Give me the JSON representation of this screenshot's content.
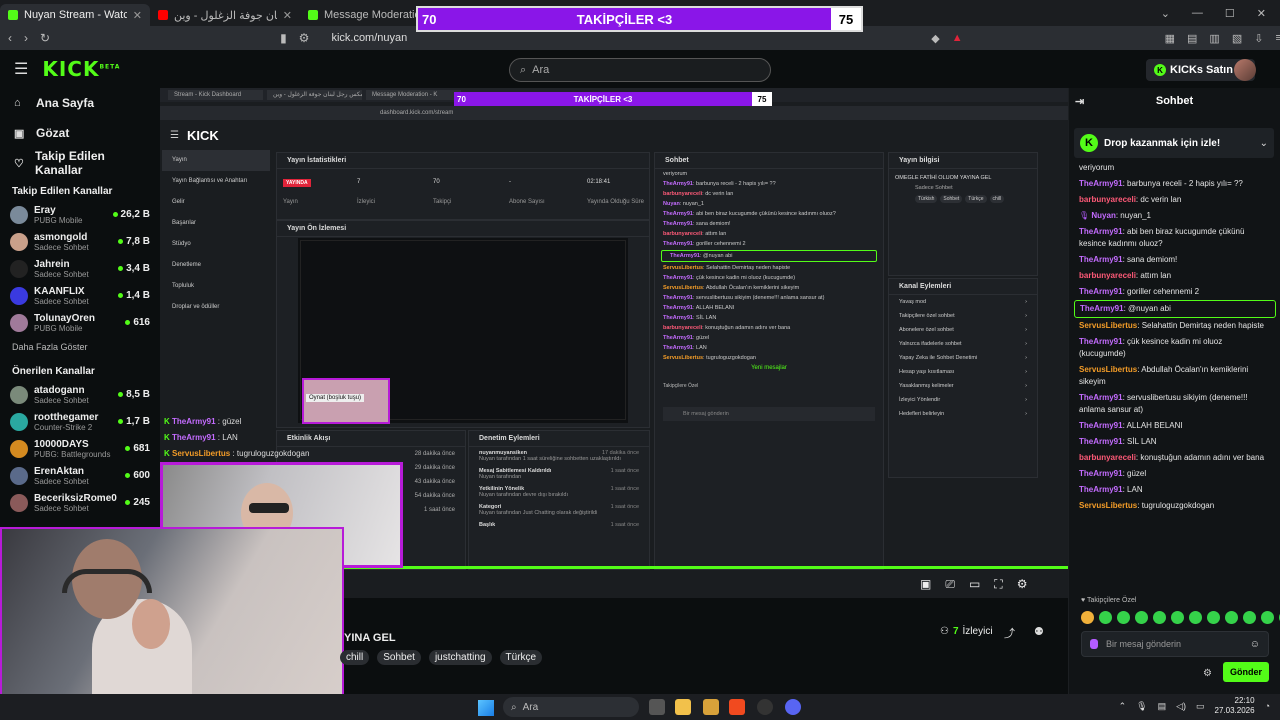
{
  "browser": {
    "tabs": [
      {
        "title": "Nuyan Stream - Watch Live on K",
        "active": true,
        "color": "#53fc18"
      },
      {
        "title": "ريمكس رجل لبنان جوفة الزغلول - وين",
        "active": false,
        "color": "#ff0000"
      },
      {
        "title": "Message Moderation - K",
        "active": false,
        "color": "#53fc18"
      }
    ],
    "url": "kick.com/nuyan"
  },
  "follower_goal": {
    "current": "70",
    "label": "TAKİPÇİLER <3",
    "target": "75",
    "progress": 0.93,
    "color": "#8a16e8"
  },
  "header": {
    "logo": "KICK",
    "logo_sup": "BETA",
    "search_placeholder": "Ara",
    "buy_label": "KICKs Satın Al"
  },
  "sidebar": {
    "nav": [
      {
        "label": "Ana Sayfa",
        "icon": "home-icon",
        "glyph": "⌂"
      },
      {
        "label": "Gözat",
        "icon": "browse-icon",
        "glyph": "▣"
      },
      {
        "label": "Takip Edilen Kanallar",
        "icon": "heart-icon",
        "glyph": "♡"
      }
    ],
    "followed_title": "Takip Edilen Kanallar",
    "followed": [
      {
        "name": "Eray",
        "category": "PUBG Mobile",
        "viewers": "26,2 B",
        "color": "#7a8a9a"
      },
      {
        "name": "asmongold",
        "category": "Sadece Sohbet",
        "viewers": "7,8 B",
        "color": "#c9a08a"
      },
      {
        "name": "Jahrein",
        "category": "Sadece Sohbet",
        "viewers": "3,4 B",
        "color": "#222222"
      },
      {
        "name": "KAANFLIX",
        "category": "Sadece Sohbet",
        "viewers": "1,4 B",
        "color": "#3a3ae0"
      },
      {
        "name": "TolunayOren",
        "category": "PUBG Mobile",
        "viewers": "616",
        "color": "#a07a9a"
      }
    ],
    "show_more": "Daha Fazla Göster",
    "recommended_title": "Önerilen Kanallar",
    "recommended": [
      {
        "name": "atadogann",
        "category": "Sadece Sohbet",
        "viewers": "8,5 B",
        "color": "#7a8a7a"
      },
      {
        "name": "rootthegamer",
        "category": "Counter-Strike 2",
        "viewers": "1,7 B",
        "color": "#2aa8a0"
      },
      {
        "name": "10000DAYS",
        "category": "PUBG: Battlegrounds",
        "viewers": "681",
        "color": "#d48a20"
      },
      {
        "name": "ErenAktan",
        "category": "Sadece Sohbet",
        "viewers": "600",
        "color": "#5a6a8a"
      },
      {
        "name": "BeceriksizRome0",
        "category": "Sadece Sohbet",
        "viewers": "245",
        "color": "#8a5a5a"
      }
    ]
  },
  "mini": {
    "tabs": [
      "Stream - Kick Dashboard",
      "ريمكس رجل لبنان جوفة الزغلول - وين",
      "Message Moderation - K"
    ],
    "url": "dashboard.kick.com/stream",
    "logo": "KICK",
    "follow_current": "70",
    "follow_label": "TAKİPÇİLER <3",
    "follow_target": "75",
    "side": [
      "Yayın",
      "Yayın Bağlantısı ve Anahtarı",
      "Gelir",
      "Başarılar",
      "Stüdyo",
      "Denetleme",
      "Topluluk",
      "Droplar ve ödüller"
    ],
    "stats_title": "Yayın İstatistikleri",
    "stats": [
      {
        "value": "YAYINDA",
        "label": "Yayın"
      },
      {
        "value": "7",
        "label": "İzleyici"
      },
      {
        "value": "70",
        "label": "Takipçi"
      },
      {
        "value": "-",
        "label": "Abone Sayısı"
      },
      {
        "value": "02:18:41",
        "label": "Yayında Olduğu Süre"
      }
    ],
    "preview_title": "Yayın Ön İzlemesi",
    "preview_tooltip": "Oynat (boşluk tuşu)",
    "activity_title": "Etkinlik Akışı",
    "activity": [
      "28 dakika önce",
      "29 dakika önce",
      "43 dakika önce",
      "54 dakika önce",
      "1 saat önce"
    ],
    "mod_title": "Denetim Eylemleri",
    "mod_actions": [
      {
        "name": "nuyanmuyansiken",
        "desc": "Nuyan tarafından 1 saat süreliğine sohbetten uzaklaştırıldı",
        "time": "17 dakika önce"
      },
      {
        "name": "Mesaj Sabitlemesi Kaldırıldı",
        "desc": "Nuyan tarafından",
        "time": "1 saat önce"
      },
      {
        "name": "Yetkilinin Yönelik",
        "desc": "Nuyan tarafından devre dışı bırakıldı",
        "time": "1 saat önce"
      },
      {
        "name": "Kategori",
        "desc": "Nuyan tarafından Just Chatting olarak değiştirildi",
        "time": "1 saat önce"
      },
      {
        "name": "Başlık",
        "desc": "",
        "time": "1 saat önce"
      }
    ],
    "chat_title": "Sohbet",
    "new_messages": "Yeni mesajlar",
    "mini_subs_label": "Takipçilere Özel",
    "chat_placeholder": "Bir mesaj gönderin",
    "send": "Gönder",
    "info_title": "Yayın bilgisi",
    "info_stream_title": "OMEGLE FATİHİ OLUOM YAYINA GEL",
    "info_category": "Sadece Sohbet",
    "info_tags": [
      "Türkish",
      "Sohbet",
      "Türkçe",
      "chill"
    ],
    "channel_actions_title": "Kanal Eylemleri",
    "channel_actions": [
      "Yavaş mod",
      "Takipçilere özel sohbet",
      "Abonelere özel sohbet",
      "Yalnızca ifadelerle sohbet",
      "Yapay Zeka ile Sohbet Denetimi",
      "Hesap yaşı kısıtlaması",
      "Yasaklanmış kelimeler",
      "İzleyici Yönlendir",
      "Hedefleri belirleyin"
    ],
    "overlay_chat": [
      {
        "user": "TheArmy91",
        "text": "güzel",
        "type": "army"
      },
      {
        "user": "TheArmy91",
        "text": "LAN",
        "type": "army"
      },
      {
        "user": "ServusLibertus",
        "text": "tugruloguzgokdogan",
        "type": "serv"
      }
    ]
  },
  "stream_info": {
    "title": "YINA GEL",
    "tags": [
      "chill",
      "Sohbet",
      "justchatting",
      "Türkçe"
    ],
    "viewer_count": "7",
    "viewer_label": "İzleyici"
  },
  "chat": {
    "title": "Sohbet",
    "drop_banner": "Drop kazanmak için izle!",
    "messages": [
      {
        "user": "",
        "text": "veriyorum",
        "type": "none"
      },
      {
        "user": "TheArmy91",
        "text": "barbunya receli - 2 hapis yılı= ??",
        "type": "army"
      },
      {
        "user": "barbunyareceli",
        "text": "dc verin lan",
        "type": "barb"
      },
      {
        "user": "Nuyan",
        "text": "nuyan_1",
        "type": "nuyan"
      },
      {
        "user": "TheArmy91",
        "text": "abi ben biraz kucugumde çükünü kesince kadınmı oluoz?",
        "type": "army"
      },
      {
        "user": "TheArmy91",
        "text": "sana demiom!",
        "type": "army"
      },
      {
        "user": "barbunyareceli",
        "text": "attım lan",
        "type": "barb"
      },
      {
        "user": "TheArmy91",
        "text": "goriller cehennemi 2",
        "type": "army"
      },
      {
        "user": "TheArmy91",
        "text": "@nuyan abi",
        "type": "army",
        "highlight": true
      },
      {
        "user": "ServusLibertus",
        "text": "Selahattin Demirtaş neden hapiste",
        "type": "serv"
      },
      {
        "user": "TheArmy91",
        "text": "çük kesince kadin mi oluoz (kucugumde)",
        "type": "army"
      },
      {
        "user": "ServusLibertus",
        "text": "Abdullah Öcalan'ın kemiklerini sikeyim",
        "type": "serv"
      },
      {
        "user": "TheArmy91",
        "text": "servuslibertusu sikiyim (deneme!!! anlama sansur at)",
        "type": "army"
      },
      {
        "user": "TheArmy91",
        "text": "ALLAH BELANI",
        "type": "army"
      },
      {
        "user": "TheArmy91",
        "text": "SİL LAN",
        "type": "army"
      },
      {
        "user": "barbunyareceli",
        "text": "konuştuğun adamın adını ver bana",
        "type": "barb"
      },
      {
        "user": "TheArmy91",
        "text": "güzel",
        "type": "army"
      },
      {
        "user": "TheArmy91",
        "text": "LAN",
        "type": "army"
      },
      {
        "user": "ServusLibertus",
        "text": "tugruloguzgokdogan",
        "type": "serv"
      }
    ],
    "subs_label": "Takipçilere Özel",
    "input_placeholder": "Bir mesaj gönderin",
    "send_label": "Gönder"
  },
  "taskbar": {
    "search_placeholder": "Ara",
    "time": "22:10",
    "date": "27.03.2026"
  }
}
